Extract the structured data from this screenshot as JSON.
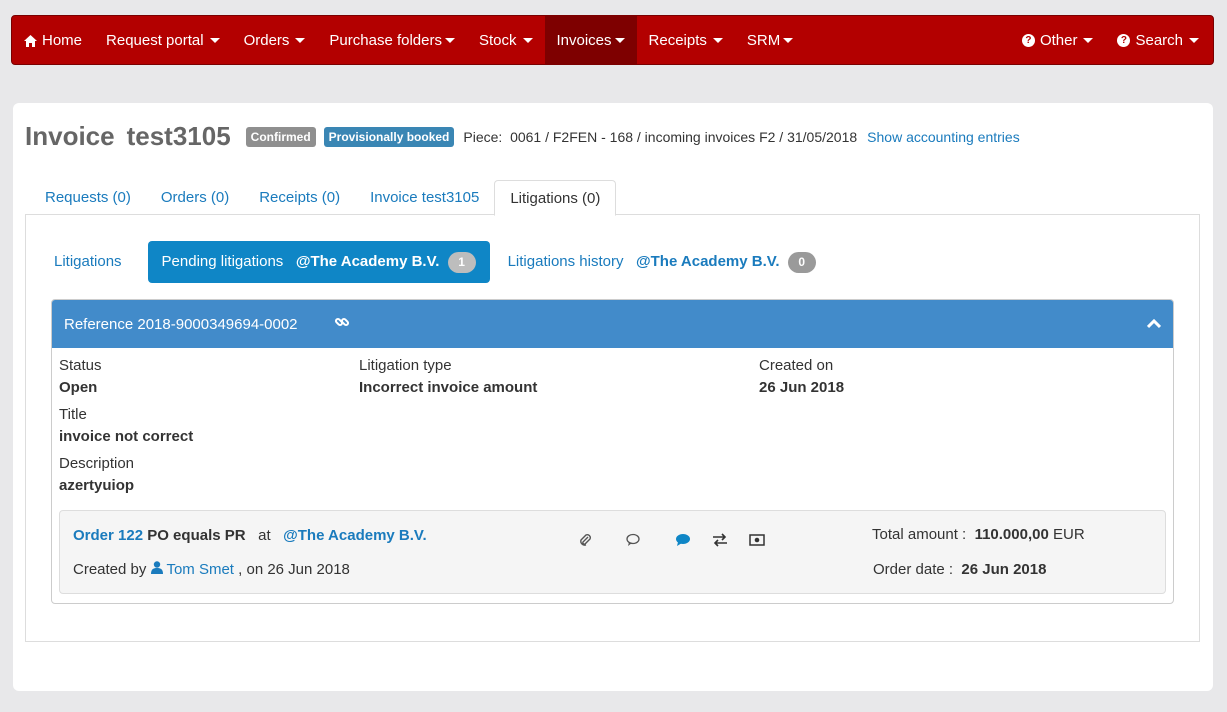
{
  "nav": {
    "home": "Home",
    "items": [
      "Request portal",
      "Orders",
      "Purchase folders",
      "Stock",
      "Invoices",
      "Receipts",
      "SRM"
    ],
    "other": "Other",
    "search": "Search"
  },
  "header": {
    "title_word": "Invoice",
    "title_id": "test3105",
    "status_confirmed": "Confirmed",
    "status_booked": "Provisionally booked",
    "piece": "Piece:  0061 / F2FEN - 168 / incoming invoices F2 / 31/05/2018",
    "show_accounting": "Show accounting entries"
  },
  "tabs": [
    "Requests (0)",
    "Orders (0)",
    "Receipts (0)",
    "Invoice test3105",
    "Litigations (0)"
  ],
  "pills": {
    "litigations": "Litigations",
    "pending": "Pending litigations",
    "pending_company": "@The Academy B.V.",
    "pending_count": "1",
    "history": "Litigations history",
    "history_company": "@The Academy B.V.",
    "history_count": "0"
  },
  "litigation": {
    "reference": "Reference 2018-9000349694-0002",
    "status_label": "Status",
    "status_value": "Open",
    "type_label": "Litigation type",
    "type_value": "Incorrect invoice amount",
    "created_label": "Created on",
    "created_value": "26 Jun 2018",
    "title_label": "Title",
    "title_value": "invoice not correct",
    "desc_label": "Description",
    "desc_value": "azertyuiop"
  },
  "order": {
    "link": "Order 122",
    "name": "PO equals PR",
    "at": "at",
    "company": "@The Academy B.V.",
    "created_by": "Created by",
    "user": "Tom Smet",
    "created_on": ", on 26 Jun 2018",
    "total_label": "Total amount :",
    "total_value": "110.000,00",
    "currency": "EUR",
    "date_label": "Order date :",
    "date_value": "26 Jun 2018",
    "icons": [
      "paperclip-icon",
      "comments-icon",
      "comment-icon",
      "exchange-icon",
      "money-icon"
    ]
  },
  "colors": {
    "navbar": "#b30000",
    "navbar_active": "#7e0000",
    "link": "#1a7bbd",
    "panel_heading": "#428bca",
    "pill_active": "#0f86c6"
  }
}
